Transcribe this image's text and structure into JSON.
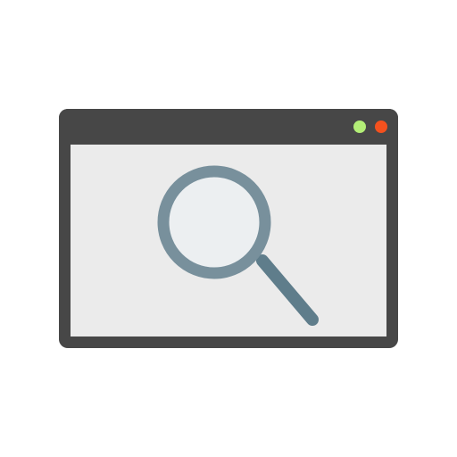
{
  "window": {
    "frame_color": "#474747",
    "content_color": "#ebebeb"
  },
  "window_controls": [
    {
      "icon": "maximize-dot-icon",
      "color": "#b3ee77"
    },
    {
      "icon": "close-dot-icon",
      "color": "#f4511e"
    }
  ],
  "content": {
    "icon": "magnifying-glass-icon",
    "lens_ring_color": "#78909c",
    "lens_glass_color": "#eceff1",
    "handle_color": "#5f7d8b"
  }
}
